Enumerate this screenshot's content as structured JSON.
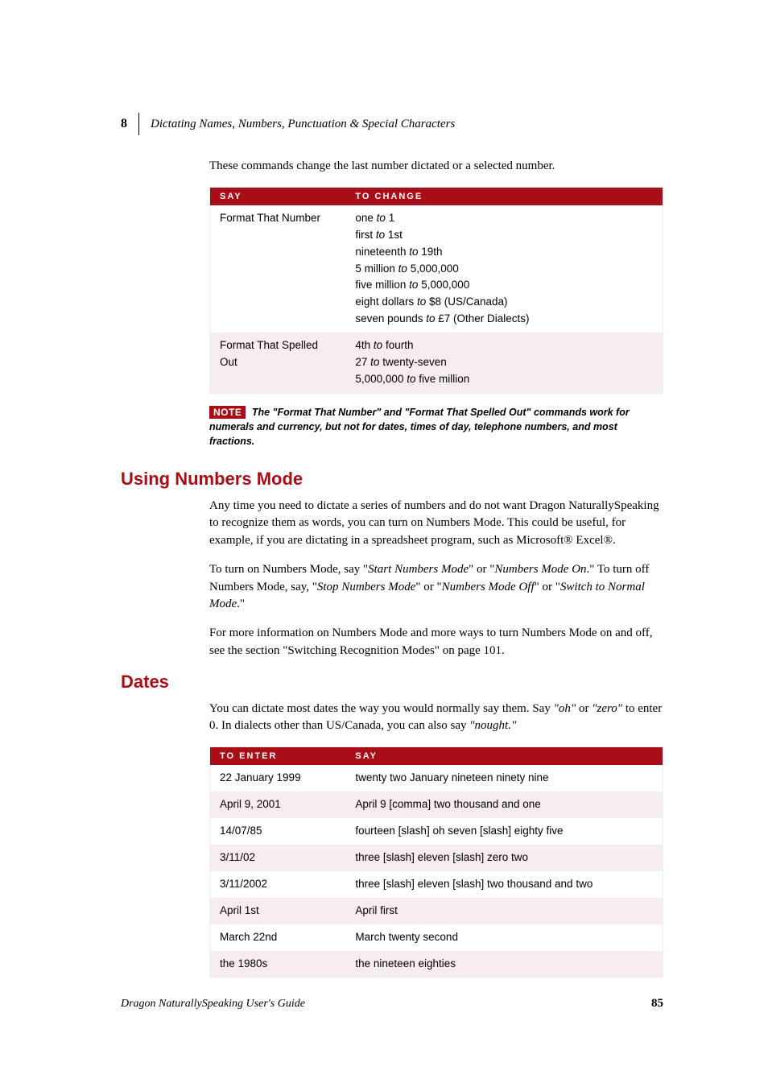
{
  "header": {
    "chapter_num": "8",
    "title": "Dictating Names, Numbers, Punctuation & Special Characters"
  },
  "intro_text": "These commands change the last number dictated or a selected number.",
  "table1": {
    "head_say": "SAY",
    "head_change": "TO CHANGE",
    "rows": [
      {
        "say": "Format That Number",
        "lines": [
          {
            "a": "one",
            "mid": " to ",
            "b": "1"
          },
          {
            "a": "first",
            "mid": " to ",
            "b": "1st"
          },
          {
            "a": "nineteenth",
            "mid": " to ",
            "b": "19th"
          },
          {
            "a": "5 million",
            "mid": " to ",
            "b": "5,000,000"
          },
          {
            "a": "five million",
            "mid": " to ",
            "b": "5,000,000"
          },
          {
            "a": "eight dollars",
            "mid": " to ",
            "b": "$8 (US/Canada)"
          },
          {
            "a": "seven pounds",
            "mid": " to ",
            "b": "£7 (Other Dialects)"
          }
        ]
      },
      {
        "say": "Format That Spelled Out",
        "lines": [
          {
            "a": "4th",
            "mid": " to ",
            "b": "fourth"
          },
          {
            "a": "27",
            "mid": " to ",
            "b": "twenty-seven"
          },
          {
            "a": "5,000,000",
            "mid": " to ",
            "b": "five million"
          }
        ]
      }
    ]
  },
  "note": {
    "label": "NOTE",
    "text": "The \"Format That Number\" and \"Format That Spelled Out\" commands work for numerals and currency, but not for dates, times of day, telephone numbers, and most fractions."
  },
  "section1": {
    "heading": "Using Numbers Mode",
    "p1": "Any time you need to dictate a series of numbers and do not want Dragon NaturallySpeaking to recognize them as words, you can turn on Numbers Mode. This could be useful, for example, if you are dictating in a spreadsheet program, such as Microsoft® Excel®.",
    "p2_a": "To turn on Numbers Mode, say \"",
    "p2_i1": "Start Numbers Mode",
    "p2_b": "\" or \"",
    "p2_i2": "Numbers Mode On",
    "p2_c": ".\" To turn off Numbers Mode, say, \"",
    "p2_i3": "Stop Numbers Mode",
    "p2_d": "\" or \"",
    "p2_i4": "Numbers Mode Off",
    "p2_e": "\" or \"",
    "p2_i5": "Switch to Normal Mode",
    "p2_f": ".\"",
    "p3": "For more information on Numbers Mode and more ways to turn Numbers Mode on and off, see the section \"Switching Recognition Modes\" on page 101."
  },
  "section2": {
    "heading": "Dates",
    "p1_a": "You can dictate most dates the way you would normally say them. Say ",
    "p1_i1": "\"oh\"",
    "p1_b": " or ",
    "p1_i2": "\"zero\"",
    "p1_c": " to enter 0. In dialects other than US/Canada, you can also say ",
    "p1_i3": "\"nought.\""
  },
  "table2": {
    "head_enter": "TO ENTER",
    "head_say": "SAY",
    "rows": [
      {
        "enter": "22 January 1999",
        "say": "twenty two January nineteen ninety nine"
      },
      {
        "enter": "April 9, 2001",
        "say": "April 9 [comma] two thousand and one"
      },
      {
        "enter": "14/07/85",
        "say": "fourteen [slash] oh seven [slash] eighty five"
      },
      {
        "enter": "3/11/02",
        "say": "three [slash] eleven [slash] zero two"
      },
      {
        "enter": "3/11/2002",
        "say": "three [slash] eleven [slash] two thousand and two"
      },
      {
        "enter": "April 1st",
        "say": "April first"
      },
      {
        "enter": "March 22nd",
        "say": "March twenty second"
      },
      {
        "enter": "the 1980s",
        "say": "the nineteen eighties"
      }
    ]
  },
  "footer": {
    "title": "Dragon NaturallySpeaking User's Guide",
    "page": "85"
  }
}
